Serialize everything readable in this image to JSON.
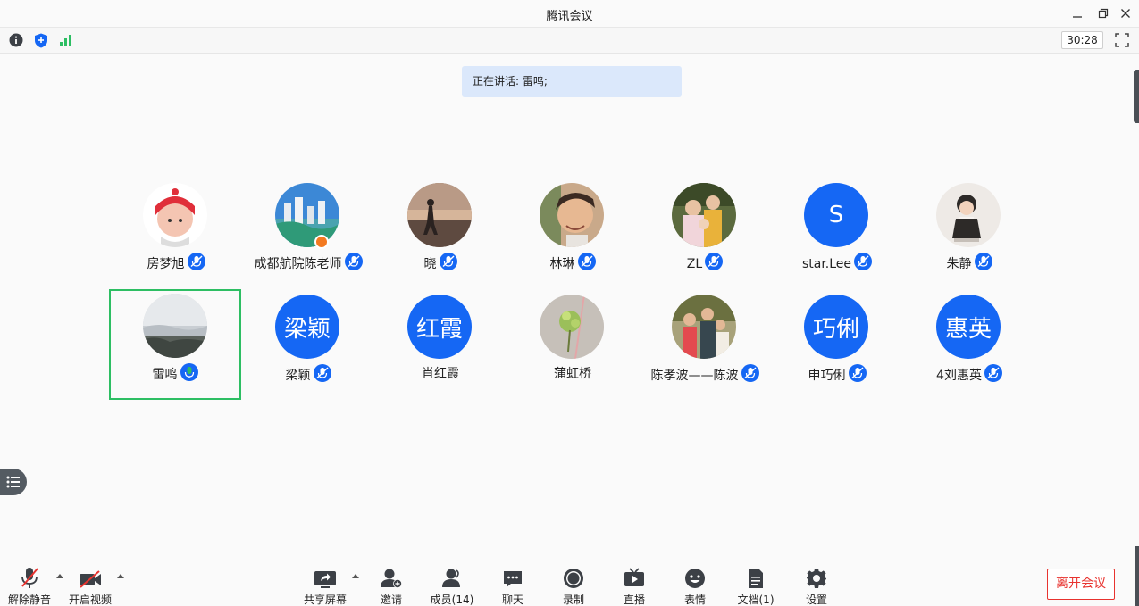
{
  "window": {
    "title": "腾讯会议"
  },
  "statusbar": {
    "timer": "30:28"
  },
  "speaking": {
    "label": "正在讲话: ",
    "name": "雷鸣;"
  },
  "participants": [
    {
      "name": "房梦旭",
      "avatar": "photo"
    },
    {
      "name": "成都航院陈老师",
      "avatar": "photo",
      "host": true
    },
    {
      "name": "晓",
      "avatar": "photo"
    },
    {
      "name": "林琳",
      "avatar": "photo"
    },
    {
      "name": "ZL",
      "avatar": "photo"
    },
    {
      "name": "star.Lee",
      "avatar": "text",
      "avatar_text": "S"
    },
    {
      "name": "朱静",
      "avatar": "photo"
    },
    {
      "name": "雷鸣",
      "avatar": "photo",
      "speaking": true
    },
    {
      "name": "梁颖",
      "avatar": "text",
      "avatar_text": "梁颖"
    },
    {
      "name": "肖红霞",
      "avatar": "text",
      "avatar_text": "红霞"
    },
    {
      "name": "蒲虹桥",
      "avatar": "photo"
    },
    {
      "name": "陈孝波——陈波",
      "avatar": "photo"
    },
    {
      "name": "申巧俐",
      "avatar": "text",
      "avatar_text": "巧俐"
    },
    {
      "name": "4刘惠英",
      "avatar": "text",
      "avatar_text": "惠英"
    }
  ],
  "toolbar": {
    "unmute": "解除静音",
    "video": "开启视频",
    "share": "共享屏幕",
    "invite": "邀请",
    "members": "成员(14)",
    "chat": "聊天",
    "record": "录制",
    "live": "直播",
    "emoji": "表情",
    "docs": "文档(1)",
    "settings": "设置",
    "leave": "离开会议"
  },
  "colors": {
    "accent": "#1567f4",
    "speaking_border": "#2dbe63",
    "leave": "#e8332f",
    "banner": "#dbe8fb"
  }
}
